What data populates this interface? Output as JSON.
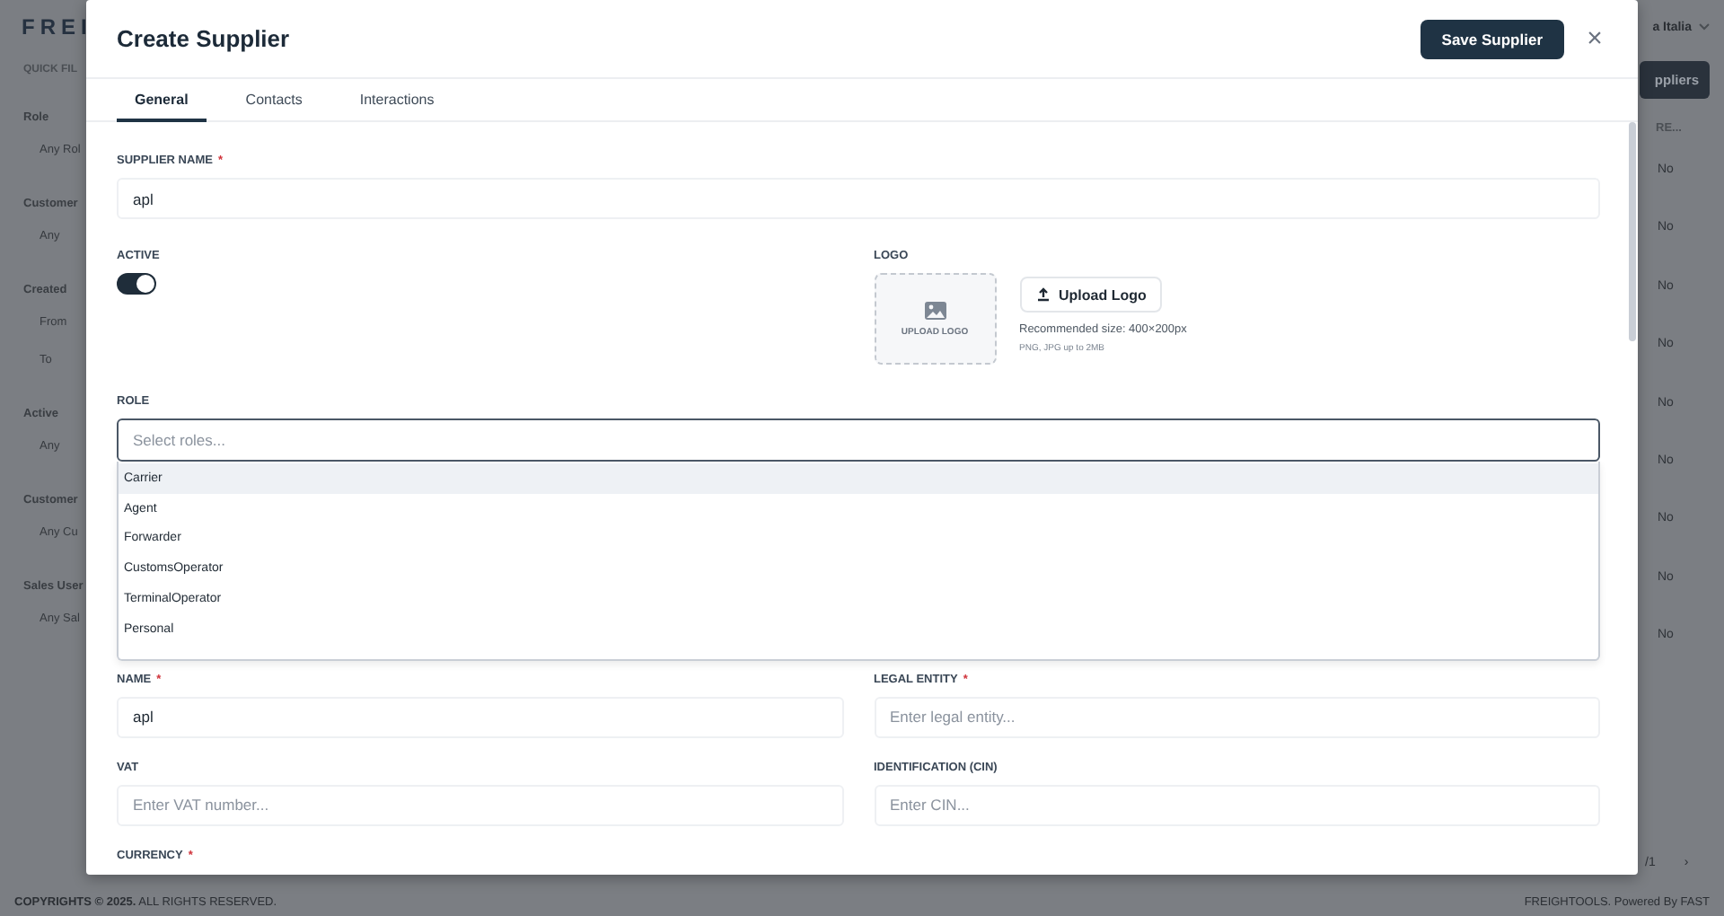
{
  "background": {
    "logo": "FREI",
    "company": "a Italia",
    "quick_filters": "QUICK FIL",
    "filters": [
      {
        "label": "Role",
        "placeholders": [
          "Any Rol"
        ]
      },
      {
        "label": "Customer",
        "placeholders": [
          "Any"
        ]
      },
      {
        "label": "Created",
        "placeholders": [
          "From",
          "To"
        ]
      },
      {
        "label": "Active",
        "placeholders": [
          "Any"
        ]
      },
      {
        "label": "Customer",
        "placeholders": [
          "Any Cu"
        ]
      },
      {
        "label": "Sales User",
        "placeholders": [
          "Any Sal"
        ]
      }
    ],
    "action_button": "ppliers",
    "table": {
      "column": "RE...",
      "rows": [
        "No",
        "No",
        "No",
        "No",
        "No",
        "No",
        "No",
        "No",
        "No"
      ]
    },
    "pagination": {
      "pages": "/1",
      "next": "›"
    },
    "footer": {
      "copyright": "**COPYRIGHTS © 2025.** ALL RIGHTS RESERVED.",
      "credit": "FREIGHTOOLS. Powered By FAST"
    }
  },
  "dialog": {
    "title": "Create Supplier",
    "save_button": "Save Supplier",
    "close": "×",
    "tabs": [
      {
        "label": "General",
        "selected": true
      },
      {
        "label": "Contacts",
        "selected": false
      },
      {
        "label": "Interactions",
        "selected": false
      }
    ],
    "supplier_name": {
      "label": "SUPPLIER NAME",
      "required_mark": "*",
      "value": "apl"
    },
    "active": {
      "label": "ACTIVE",
      "on": true
    },
    "logo": {
      "label": "LOGO",
      "dropzone_text": "UPLOAD LOGO",
      "upload_button": "Upload Logo",
      "hint": "Recommended size: 400×200px",
      "formats": "PNG, JPG up to 2MB"
    },
    "role": {
      "label": "ROLE",
      "placeholder": "Select roles...",
      "options": [
        {
          "label": "Carrier",
          "highlighted": true
        },
        {
          "label": "Agent",
          "highlighted": false
        },
        {
          "label": "Forwarder",
          "highlighted": false
        },
        {
          "label": "CustomsOperator",
          "highlighted": false
        },
        {
          "label": "TerminalOperator",
          "highlighted": false
        },
        {
          "label": "Personal",
          "highlighted": false
        }
      ]
    },
    "name": {
      "label": "NAME",
      "required_mark": "*",
      "value": "apl"
    },
    "legal_entity": {
      "label": "LEGAL ENTITY",
      "required_mark": "*",
      "placeholder": "Enter legal entity..."
    },
    "vat": {
      "label": "VAT",
      "placeholder": "Enter VAT number..."
    },
    "cin": {
      "label": "IDENTIFICATION (CIN)",
      "placeholder": "Enter CIN..."
    },
    "currency": {
      "label": "CURRENCY",
      "required_mark": "*"
    }
  }
}
